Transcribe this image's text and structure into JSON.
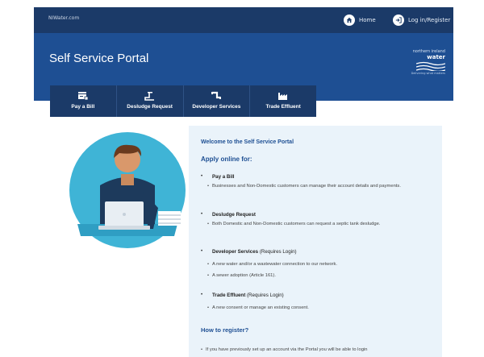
{
  "header": {
    "site_name": "NIWater.com",
    "home_label": "Home",
    "login_label": "Log in/Register"
  },
  "hero": {
    "title": "Self Service Portal",
    "logo_line1": "northern ireland",
    "logo_line2": "water",
    "logo_tagline": "Delivering what matters"
  },
  "tabs": [
    {
      "label": "Pay a Bill",
      "icon": "bill-icon"
    },
    {
      "label": "Desludge Request",
      "icon": "tap-icon"
    },
    {
      "label": "Developer Services",
      "icon": "pipe-icon"
    },
    {
      "label": "Trade Effluent",
      "icon": "factory-icon"
    }
  ],
  "content": {
    "welcome": "Welcome to the Self Service Portal",
    "apply_heading": "Apply online for:",
    "items": [
      {
        "name": "Pay a Bill",
        "note": "",
        "subs": [
          "Businesses and Non-Domestic customers can manage their account details and payments."
        ]
      },
      {
        "name": "Desludge Request",
        "note": "",
        "subs": [
          "Both Domestic and Non-Domestic customers can request a septic tank desludge."
        ]
      },
      {
        "name": "Developer Services",
        "note": " (Requires Login)",
        "subs": [
          "A new water and/or a wastewater connection to our network.",
          "A sewer adoption (Article 161)."
        ]
      },
      {
        "name": "Trade Effluent",
        "note": " (Requires Login)",
        "subs": [
          "A new consent or manage an existing consent."
        ]
      }
    ],
    "register_heading": "How to register?",
    "register_items": [
      "If you have previously set up an account via the Portal you will be able to login"
    ]
  },
  "colors": {
    "navy": "#1b3a68",
    "blue": "#1e4f93",
    "panel": "#eaf3fa",
    "teal": "#3fb4d6"
  }
}
